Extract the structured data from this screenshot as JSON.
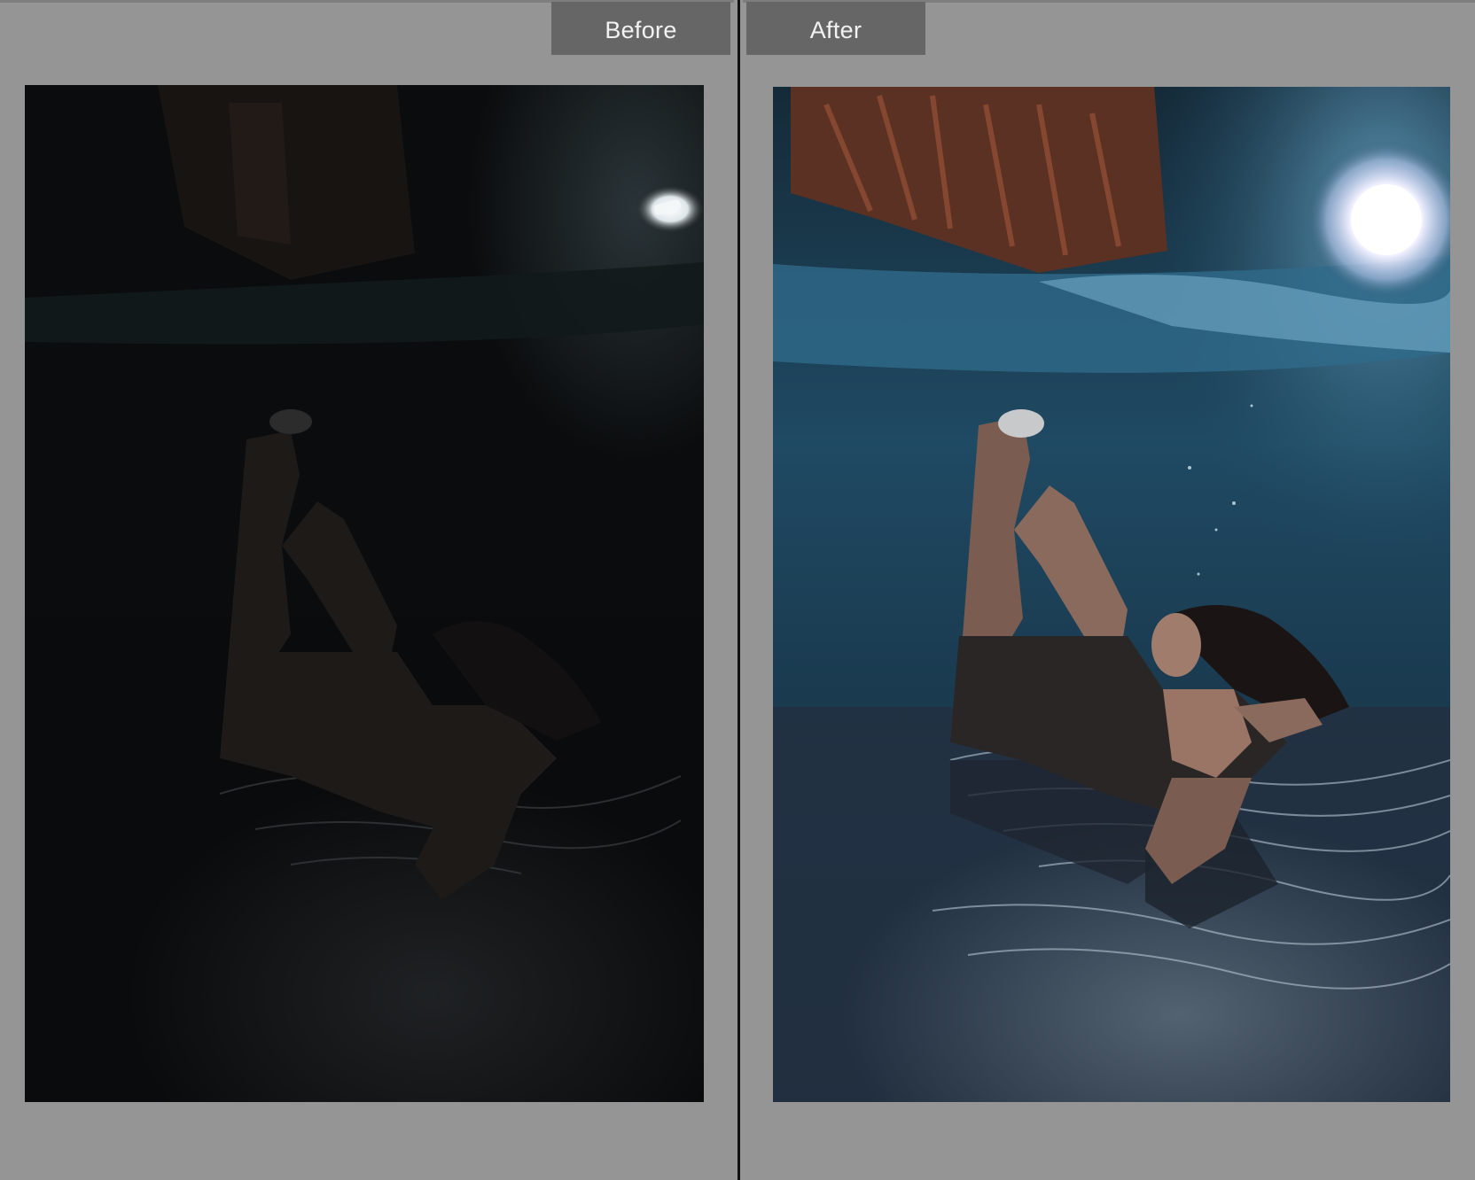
{
  "view": {
    "before_label": "Before",
    "after_label": "After"
  },
  "colors": {
    "background": "#959595",
    "tab_background": "#666666",
    "tab_text": "#f2f2f2",
    "divider": "#111111",
    "before_tone": "#0b0d0e",
    "after_tone": "#1e3d52",
    "after_light": "#ffffff",
    "after_warm_stairs": "#7a3f2c"
  },
  "icons": {
    "before_photo": "underwater-photo-before-edit",
    "after_photo": "underwater-photo-after-edit"
  }
}
